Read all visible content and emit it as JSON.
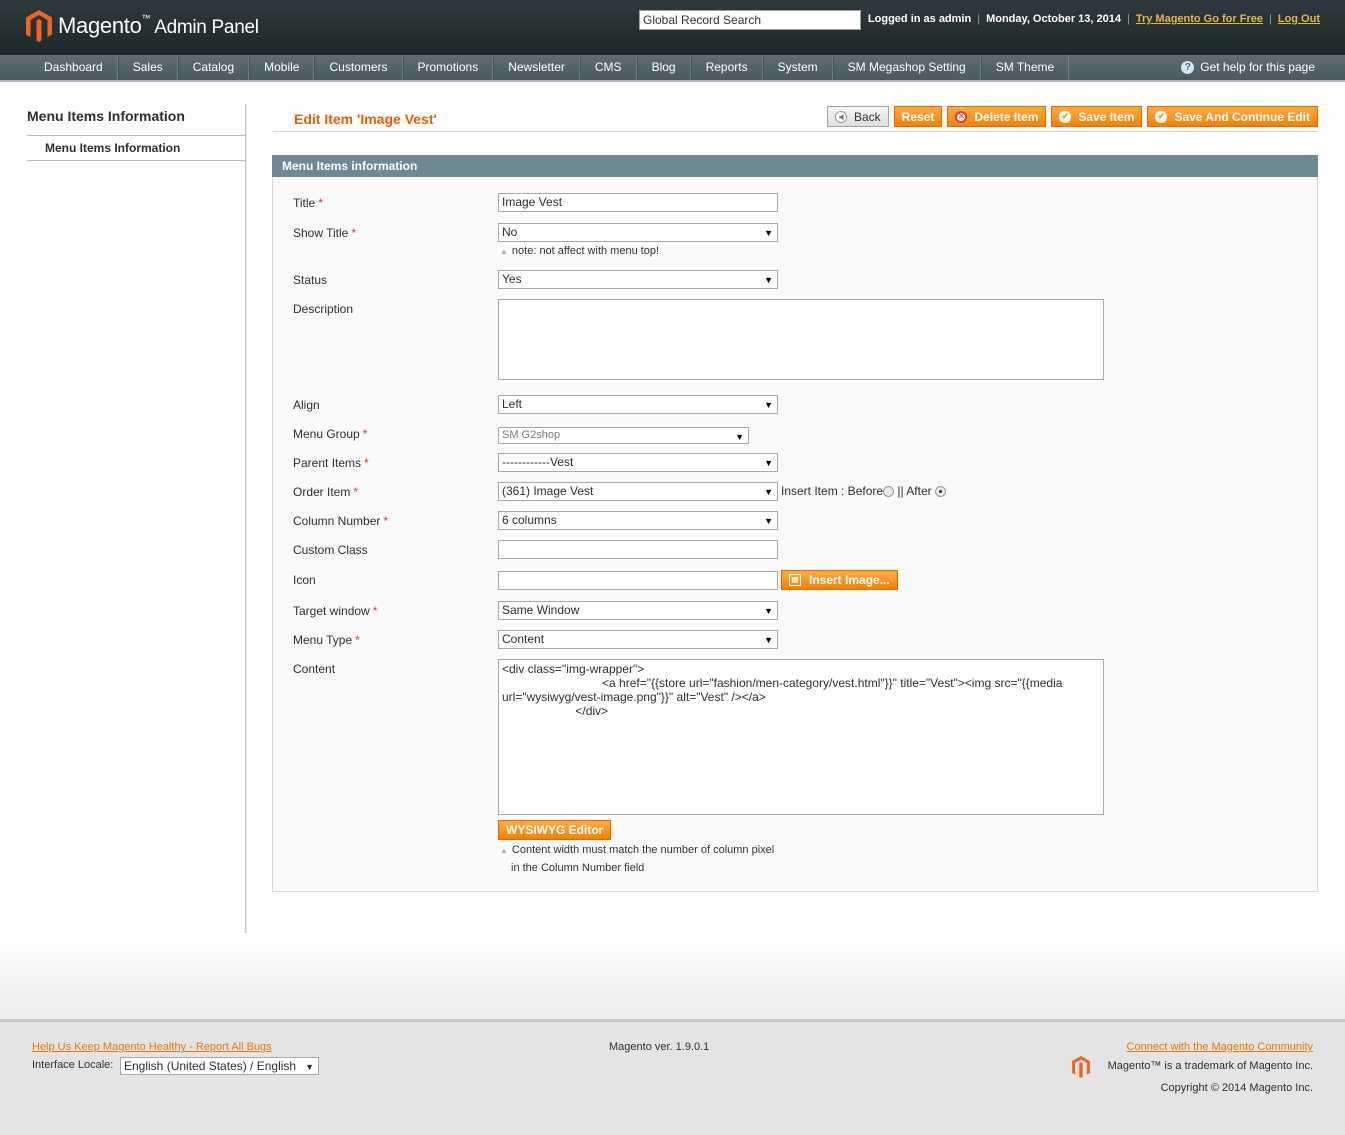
{
  "header": {
    "logo_text": "Magento",
    "logo_sub": "Admin Panel",
    "search_value": "Global Record Search",
    "logged_in": "Logged in as admin",
    "date": "Monday, October 13, 2014",
    "try_link": "Try Magento Go for Free",
    "logout": "Log Out"
  },
  "nav": {
    "items": [
      "Dashboard",
      "Sales",
      "Catalog",
      "Mobile",
      "Customers",
      "Promotions",
      "Newsletter",
      "CMS",
      "Blog",
      "Reports",
      "System",
      "SM Megashop Setting",
      "SM Theme"
    ],
    "help": "Get help for this page"
  },
  "sidebar": {
    "title": "Menu Items Information",
    "item": "Menu Items Information"
  },
  "page": {
    "title": "Edit Item 'Image Vest'",
    "buttons": {
      "back": "Back",
      "reset": "Reset",
      "delete": "Delete Item",
      "save": "Save Item",
      "save_continue": "Save And Continue Edit"
    }
  },
  "form": {
    "section_title": "Menu Items information",
    "title_label": "Title",
    "title_value": "Image Vest",
    "show_title_label": "Show Title",
    "show_title_value": "No",
    "show_title_note": "note: not affect with menu top!",
    "status_label": "Status",
    "status_value": "Yes",
    "description_label": "Description",
    "description_value": "",
    "align_label": "Align",
    "align_value": "Left",
    "menu_group_label": "Menu Group",
    "menu_group_value": "SM G2shop",
    "parent_label": "Parent Items",
    "parent_value": "------------Vest",
    "order_label": "Order Item",
    "order_value": "(361) Image Vest",
    "insert_label": "Insert Item : Before",
    "insert_sep": "|| After",
    "column_label": "Column Number",
    "column_value": "6 columns",
    "custom_class_label": "Custom Class",
    "custom_class_value": "",
    "icon_label": "Icon",
    "icon_value": "",
    "insert_image": "Insert Image...",
    "target_label": "Target window",
    "target_value": "Same Window",
    "menu_type_label": "Menu Type",
    "menu_type_value": "Content",
    "content_label": "Content",
    "content_value": "<div class=\"img-wrapper\">\n                              <a href=\"{{store url=\"fashion/men-category/vest.html\"}}\" title=\"Vest\"><img src=\"{{media url=\"wysiwyg/vest-image.png\"}}\" alt=\"Vest\" /></a>\n                      </div>",
    "wysiwyg": "WYSIWYG Editor",
    "content_note_1": "Content width must match the number of column pixel",
    "content_note_2": "in the Column Number field"
  },
  "footer": {
    "report_link": "Help Us Keep Magento Healthy - Report All Bugs",
    "locale_label": "Interface Locale:",
    "locale_value": "English (United States) / English",
    "version": "Magento ver. 1.9.0.1",
    "community_link": "Connect with the Magento Community",
    "trademark": "Magento™ is a trademark of Magento Inc.",
    "copyright": "Copyright © 2014 Magento Inc."
  },
  "colors": {
    "accent": "#eb5e00",
    "button": "#f18200",
    "section_header": "#6f8992",
    "header_bg": "#23302f"
  }
}
